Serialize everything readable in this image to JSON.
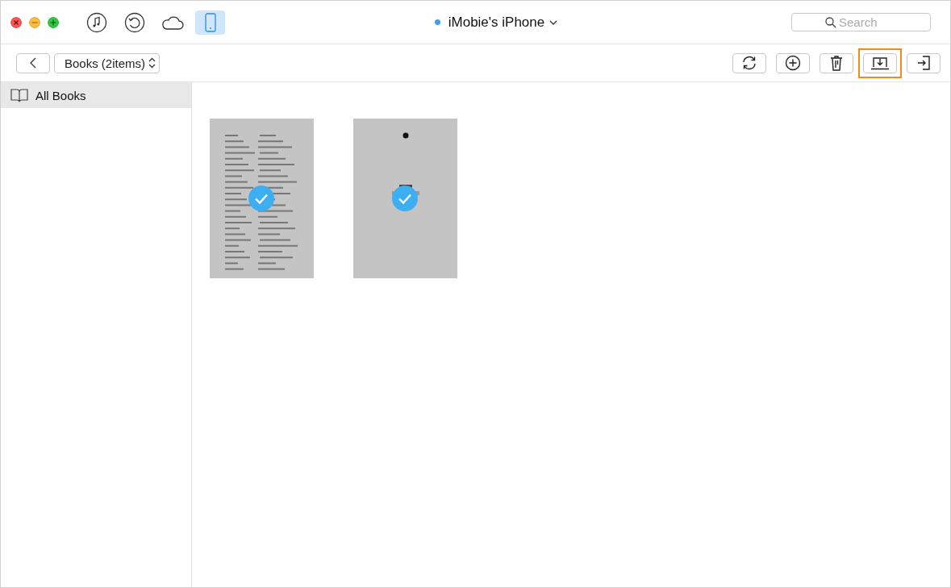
{
  "window": {
    "title": "iMobie's iPhone",
    "connected": true
  },
  "nav_icons": [
    {
      "kind": "music",
      "selected": false
    },
    {
      "kind": "history",
      "selected": false
    },
    {
      "kind": "cloud",
      "selected": false
    },
    {
      "kind": "phone",
      "selected": true
    }
  ],
  "search": {
    "placeholder": "Search"
  },
  "category_select": {
    "value": "Books (2items)"
  },
  "actions": [
    {
      "kind": "refresh",
      "selected": false
    },
    {
      "kind": "add",
      "selected": false
    },
    {
      "kind": "delete",
      "selected": false
    },
    {
      "kind": "export",
      "selected": true
    },
    {
      "kind": "import",
      "selected": false
    }
  ],
  "sidebar": {
    "items": [
      {
        "label": "All Books",
        "selected": true
      }
    ]
  },
  "books": [
    {
      "kind": "text-page",
      "selected": true
    },
    {
      "kind": "cover",
      "selected": true
    }
  ]
}
